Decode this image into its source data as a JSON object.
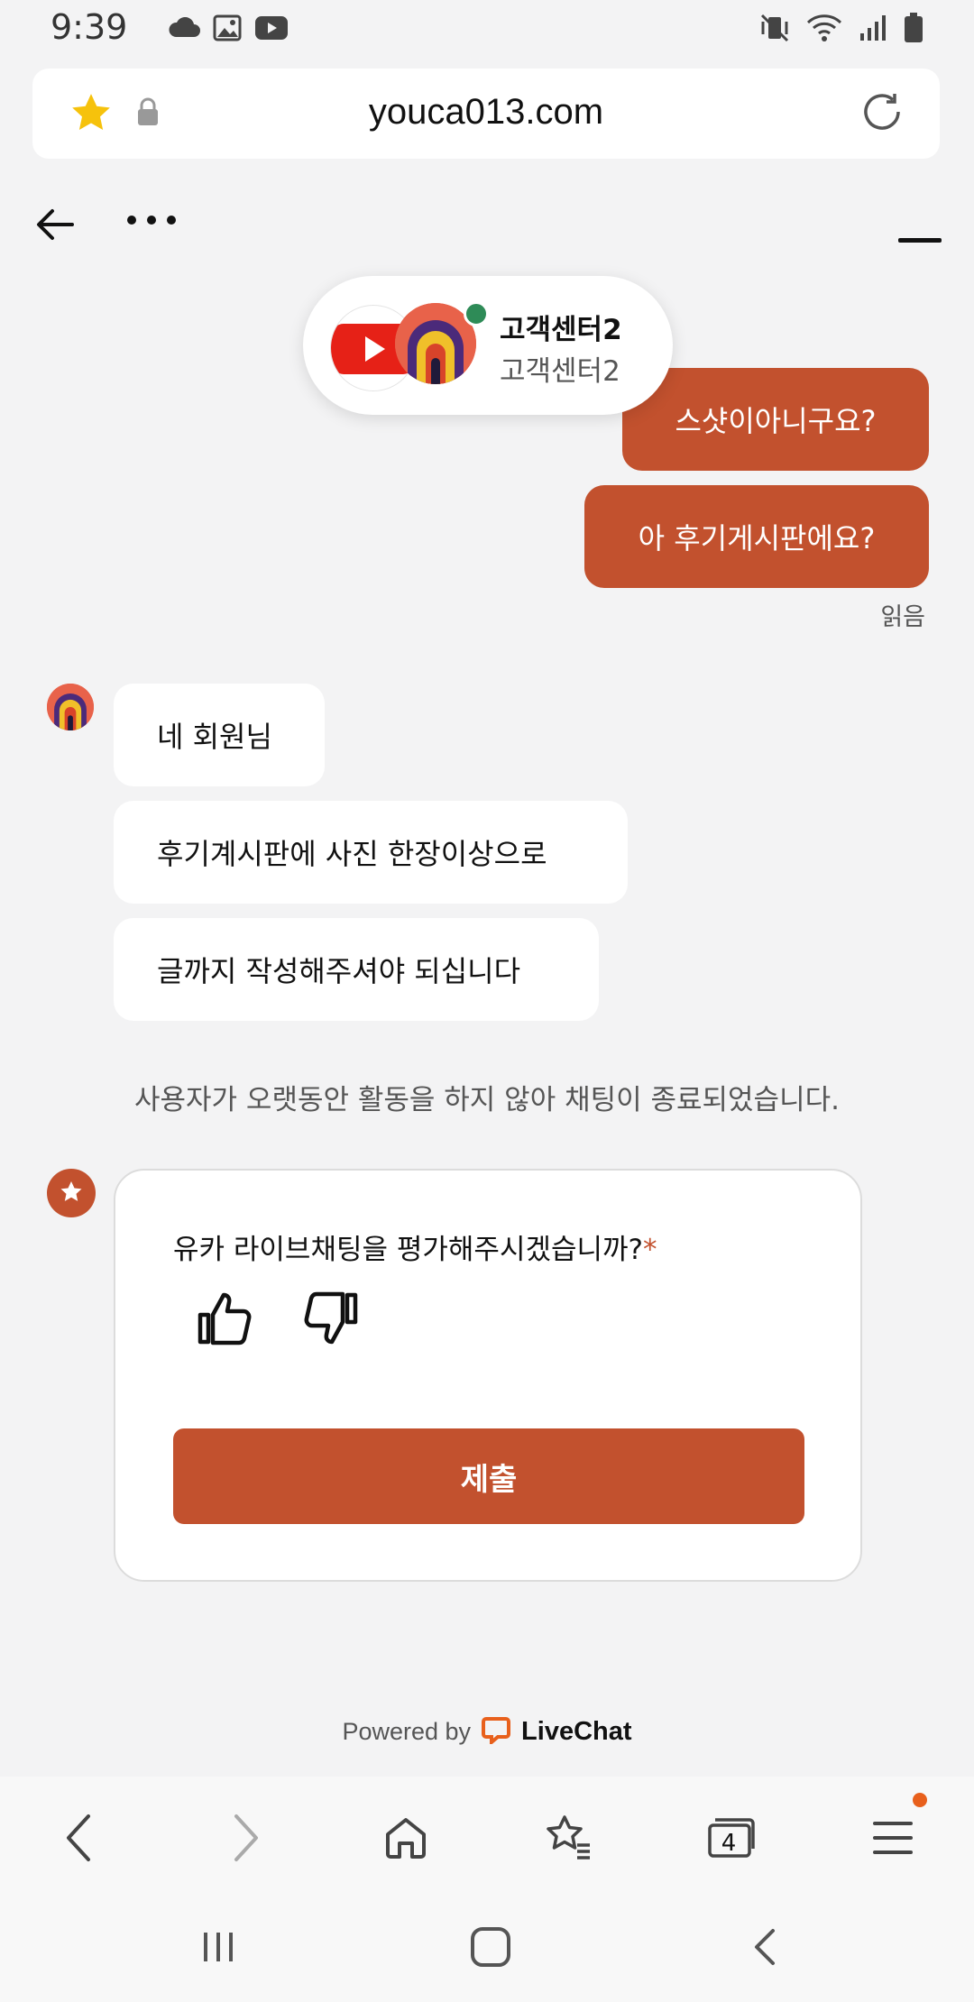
{
  "status_bar": {
    "time": "9:39",
    "left_icons": [
      "cloud-icon",
      "gallery-icon",
      "youtube-icon"
    ],
    "right_icons": [
      "vibrate-mute-icon",
      "wifi-icon",
      "signal-icon",
      "battery-icon"
    ]
  },
  "browser": {
    "url": "youca013.com",
    "toolbar": {
      "tabs_count": "4",
      "icons": [
        "back-icon",
        "forward-icon",
        "home-icon",
        "bookmarks-icon",
        "tabs-icon",
        "menu-icon"
      ]
    }
  },
  "chat": {
    "agent": {
      "name": "고객센터2",
      "subtitle": "고객센터2",
      "status_color": "#2e8b57"
    },
    "messages_out": [
      {
        "text": "스샷이아니구요?"
      },
      {
        "text": "아 후기게시판에요?"
      }
    ],
    "read_receipt": "읽음",
    "messages_in": [
      {
        "text": "네 회원님"
      },
      {
        "text": "후기계시판에 사진 한장이상으로"
      },
      {
        "text": "글까지 작성해주셔야 되십니다"
      }
    ],
    "system_note": "사용자가 오랫동안 활동을 하지 않아 채팅이 종료되었습니다.",
    "rating": {
      "question": "유카 라이브채팅을 평가해주시겠습니까?",
      "required_mark": "*",
      "submit_label": "제출"
    },
    "powered_by": "Powered by",
    "powered_brand": "LiveChat"
  },
  "colors": {
    "accent": "#c2512e",
    "background": "#f3f3f4"
  }
}
